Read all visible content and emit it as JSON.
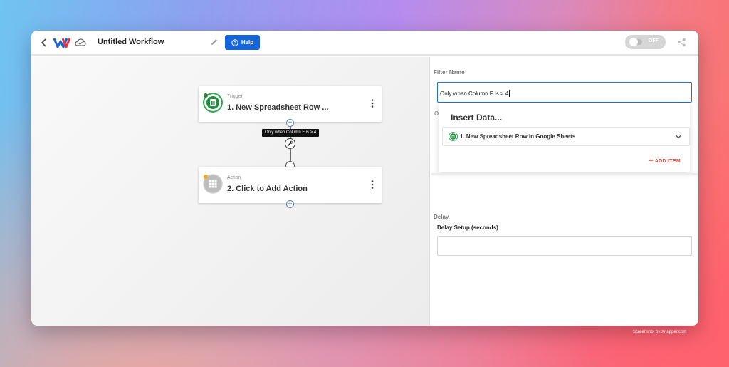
{
  "header": {
    "title": "Untitled Workflow",
    "help_label": "Help",
    "toggle_label": "OFF"
  },
  "workflow": {
    "trigger": {
      "type_label": "Trigger",
      "name": "1. New Spreadsheet Row ...",
      "status_color": "#2e7d32"
    },
    "filter_tooltip": "Only when Column F is > 4",
    "action": {
      "type_label": "Action",
      "name": "2. Click to Add Action",
      "status_color": "#f5a623"
    }
  },
  "panel": {
    "filter_name_label": "Filter Name",
    "filter_name_value": "Only when Column F is > 4",
    "hidden_label_fragment": "O",
    "insert_data": {
      "title": "Insert Data...",
      "option_label": "1. New Spreadsheet Row in Google Sheets"
    },
    "add_item_label": "ADD ITEM",
    "delay_label": "Delay",
    "delay_setup_label": "Delay Setup (seconds)",
    "delay_value": ""
  },
  "footer": {
    "watermark": "Screenshot by Xnapper.com"
  },
  "colors": {
    "accent": "#1565d8",
    "add_item": "#e04b3f",
    "sheets_green": "#1e8e3e"
  }
}
